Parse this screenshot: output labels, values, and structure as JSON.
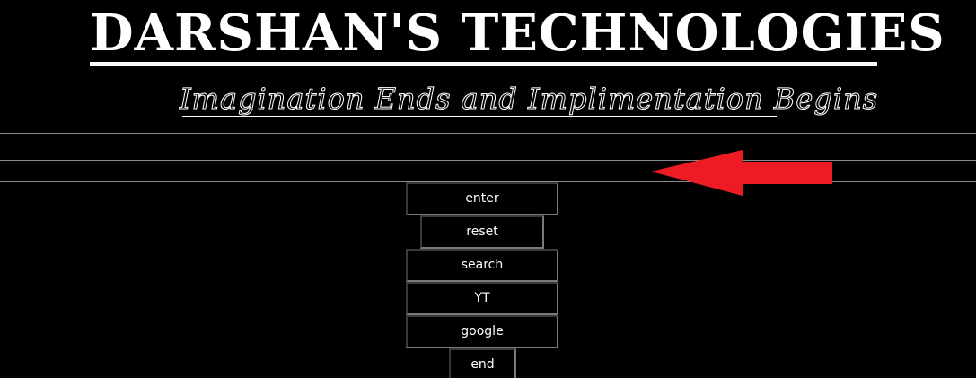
{
  "header": {
    "title": "DARSHAN'S TECHNOLOGIES",
    "tagline": "Imagination Ends and Implimentation Begins"
  },
  "input": {
    "value": "",
    "placeholder": ""
  },
  "arrow": {
    "icon": "arrow-left-icon",
    "color": "#ed1c24"
  },
  "buttons": {
    "enter": "enter",
    "reset": "reset",
    "search": "search",
    "yt": "YT",
    "google": "google",
    "end": "end"
  },
  "colors": {
    "background": "#000000",
    "text": "#ffffff",
    "arrow": "#ed1c24"
  }
}
